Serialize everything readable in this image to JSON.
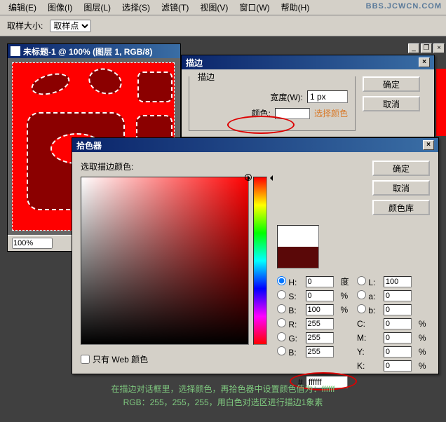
{
  "watermark": "BBS.JCWCN.COM",
  "menu": {
    "edit": "编辑(E)",
    "image": "图像(I)",
    "layer": "图层(L)",
    "select": "选择(S)",
    "filter": "滤镜(T)",
    "view": "视图(V)",
    "window": "窗口(W)",
    "help": "帮助(H)"
  },
  "toolbar": {
    "sample_size": "取样大小:",
    "sample_point": "取样点"
  },
  "doc": {
    "title": "未标题-1 @ 100% (图层 1, RGB/8)",
    "zoom": "100%"
  },
  "stroke_dialog": {
    "title": "描边",
    "group_legend": "描边",
    "width_label": "宽度(W):",
    "width_value": "1 px",
    "color_label": "颜色:",
    "select_color": "选择颜色",
    "ok": "确定",
    "cancel": "取消"
  },
  "picker_dialog": {
    "title": "拾色器",
    "prompt": "选取描边颜色:",
    "ok": "确定",
    "cancel": "取消",
    "color_lib": "颜色库",
    "H": {
      "label": "H:",
      "value": "0",
      "unit": "度"
    },
    "S": {
      "label": "S:",
      "value": "0",
      "unit": "%"
    },
    "Bval": {
      "label": "B:",
      "value": "100",
      "unit": "%"
    },
    "L": {
      "label": "L:",
      "value": "100"
    },
    "a": {
      "label": "a:",
      "value": "0"
    },
    "bLab": {
      "label": "b:",
      "value": "0"
    },
    "R": {
      "label": "R:",
      "value": "255"
    },
    "G": {
      "label": "G:",
      "value": "255"
    },
    "Bch": {
      "label": "B:",
      "value": "255"
    },
    "C": {
      "label": "C:",
      "value": "0",
      "unit": "%"
    },
    "M": {
      "label": "M:",
      "value": "0",
      "unit": "%"
    },
    "Y": {
      "label": "Y:",
      "value": "0",
      "unit": "%"
    },
    "K": {
      "label": "K:",
      "value": "0",
      "unit": "%"
    },
    "hex_label": "#",
    "hex_value": "ffffff",
    "web_only": "只有 Web 颜色"
  },
  "caption": {
    "line1": "在描边对话框里，选择颜色，再拾色器中设置颜色值为：ffffff",
    "line2": "RGB：255，255，255，用白色对选区进行描边1象素"
  }
}
